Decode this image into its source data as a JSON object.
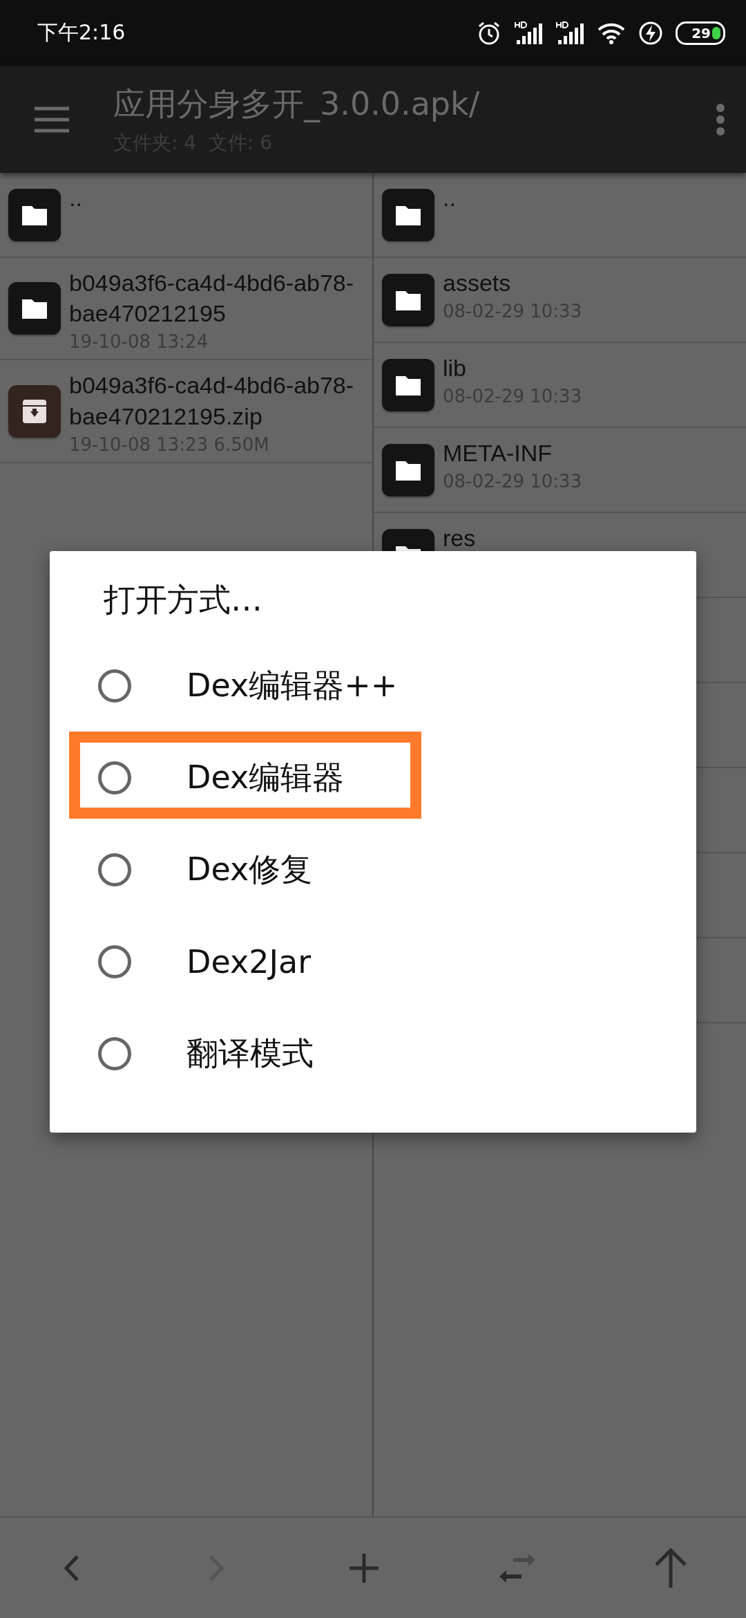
{
  "status_bar": {
    "time": "下午2:16",
    "battery": "29"
  },
  "toolbar": {
    "title": "应用分身多开_3.0.0.apk/",
    "subtitle": "文件夹: 4  文件: 6"
  },
  "left_pane": {
    "items": [
      {
        "kind": "folder",
        "name": ".."
      },
      {
        "kind": "folder",
        "name": "b049a3f6-ca4d-4bd6-ab78-bae470212195",
        "meta": "19-10-08 13:24"
      },
      {
        "kind": "archive",
        "name": "b049a3f6-ca4d-4bd6-ab78-bae470212195.zip",
        "meta": "19-10-08 13:23 6.50M"
      }
    ]
  },
  "right_pane": {
    "items": [
      {
        "kind": "folder",
        "name": ".."
      },
      {
        "kind": "folder",
        "name": "assets",
        "meta": "08-02-29 10:33"
      },
      {
        "kind": "folder",
        "name": "lib",
        "meta": "08-02-29 10:33"
      },
      {
        "kind": "folder",
        "name": "META-INF",
        "meta": "08-02-29 10:33"
      },
      {
        "kind": "folder",
        "name": "res"
      }
    ]
  },
  "dialog": {
    "title": "打开方式…",
    "options": [
      {
        "label": "Dex编辑器++",
        "selected": false,
        "highlighted": false
      },
      {
        "label": "Dex编辑器",
        "selected": false,
        "highlighted": true
      },
      {
        "label": "Dex修复",
        "selected": false,
        "highlighted": false
      },
      {
        "label": "Dex2Jar",
        "selected": false,
        "highlighted": false
      },
      {
        "label": "翻译模式",
        "selected": false,
        "highlighted": false
      }
    ]
  },
  "bottom_bar": {
    "buttons": [
      {
        "kind": "back",
        "disabled": false
      },
      {
        "kind": "forward",
        "disabled": true
      },
      {
        "kind": "add",
        "disabled": false
      },
      {
        "kind": "swap",
        "disabled": false
      },
      {
        "kind": "up",
        "disabled": false
      }
    ]
  }
}
